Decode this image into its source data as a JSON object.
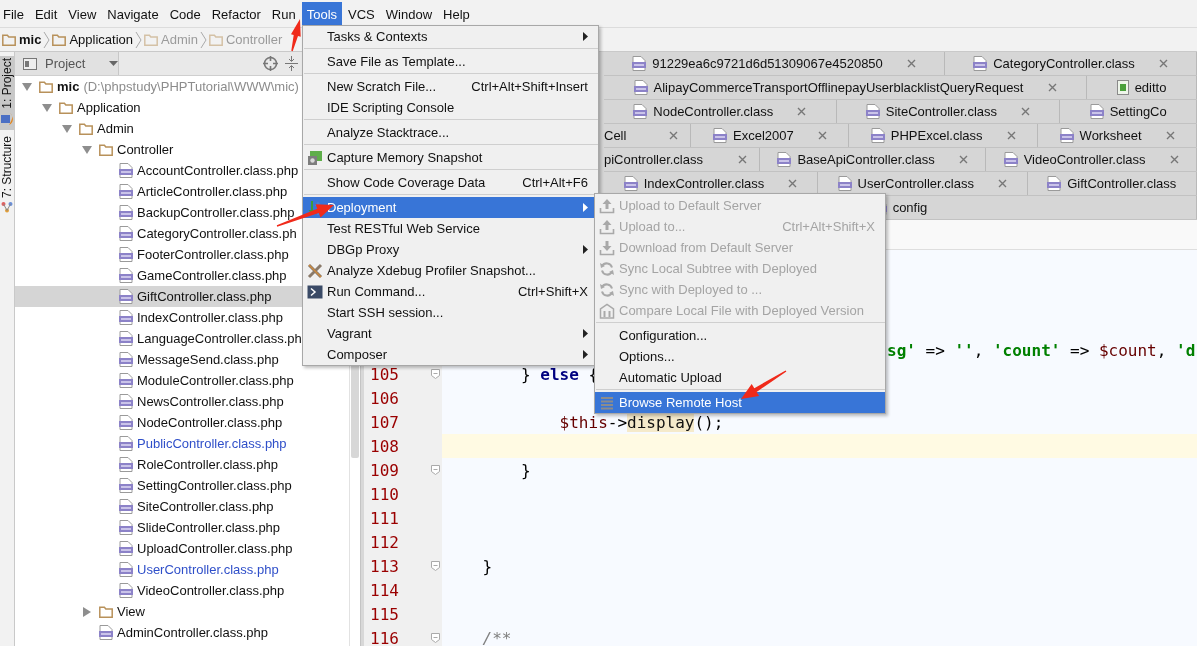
{
  "menubar": [
    {
      "label": "File",
      "selected": false
    },
    {
      "label": "Edit",
      "selected": false
    },
    {
      "label": "View",
      "selected": false
    },
    {
      "label": "Navigate",
      "selected": false
    },
    {
      "label": "Code",
      "selected": false
    },
    {
      "label": "Refactor",
      "selected": false
    },
    {
      "label": "Run",
      "selected": false
    },
    {
      "label": "Tools",
      "selected": true
    },
    {
      "label": "VCS",
      "selected": false
    },
    {
      "label": "Window",
      "selected": false
    },
    {
      "label": "Help",
      "selected": false
    }
  ],
  "breadcrumbs": [
    {
      "label": "mic",
      "bold": true,
      "dimmed": false
    },
    {
      "label": "Application",
      "bold": false,
      "dimmed": false
    },
    {
      "label": "Admin",
      "bold": false,
      "dimmed": true
    },
    {
      "label": "Controller",
      "bold": false,
      "dimmed": true
    }
  ],
  "tool_strip": [
    {
      "label": "1: Project",
      "selected": true
    },
    {
      "label": "7: Structure",
      "selected": false
    }
  ],
  "project_panel": {
    "title": "Project",
    "tree": [
      {
        "label": "mic",
        "kind": "module",
        "path": "(D:\\phpstudy\\PHPTutorial\\WWW\\mic)",
        "expanded": true,
        "selected": false,
        "children": [
          {
            "label": "Application",
            "kind": "folder",
            "expanded": true,
            "selected": false,
            "children": [
              {
                "label": "Admin",
                "kind": "folder",
                "expanded": true,
                "selected": false,
                "children": [
                  {
                    "label": "Controller",
                    "kind": "folder",
                    "expanded": true,
                    "selected": false,
                    "children": [
                      {
                        "label": "AccountController.class.php",
                        "kind": "file",
                        "modified": false,
                        "selected": false
                      },
                      {
                        "label": "ArticleController.class.php",
                        "kind": "file",
                        "modified": false,
                        "selected": false
                      },
                      {
                        "label": "BackupController.class.php",
                        "kind": "file",
                        "modified": false,
                        "selected": false
                      },
                      {
                        "label": "CategoryController.class.ph",
                        "kind": "file",
                        "modified": false,
                        "selected": false
                      },
                      {
                        "label": "FooterController.class.php",
                        "kind": "file",
                        "modified": false,
                        "selected": false
                      },
                      {
                        "label": "GameController.class.php",
                        "kind": "file",
                        "modified": false,
                        "selected": false
                      },
                      {
                        "label": "GiftController.class.php",
                        "kind": "file",
                        "modified": false,
                        "selected": true
                      },
                      {
                        "label": "IndexController.class.php",
                        "kind": "file",
                        "modified": false,
                        "selected": false
                      },
                      {
                        "label": "LanguageController.class.ph",
                        "kind": "file",
                        "modified": false,
                        "selected": false
                      },
                      {
                        "label": "MessageSend.class.php",
                        "kind": "file",
                        "modified": false,
                        "selected": false
                      },
                      {
                        "label": "ModuleController.class.php",
                        "kind": "file",
                        "modified": false,
                        "selected": false
                      },
                      {
                        "label": "NewsController.class.php",
                        "kind": "file",
                        "modified": false,
                        "selected": false
                      },
                      {
                        "label": "NodeController.class.php",
                        "kind": "file",
                        "modified": false,
                        "selected": false
                      },
                      {
                        "label": "PublicController.class.php",
                        "kind": "file",
                        "modified": true,
                        "selected": false
                      },
                      {
                        "label": "RoleController.class.php",
                        "kind": "file",
                        "modified": false,
                        "selected": false
                      },
                      {
                        "label": "SettingController.class.php",
                        "kind": "file",
                        "modified": false,
                        "selected": false
                      },
                      {
                        "label": "SiteController.class.php",
                        "kind": "file",
                        "modified": false,
                        "selected": false
                      },
                      {
                        "label": "SlideController.class.php",
                        "kind": "file",
                        "modified": false,
                        "selected": false
                      },
                      {
                        "label": "UploadController.class.php",
                        "kind": "file",
                        "modified": false,
                        "selected": false
                      },
                      {
                        "label": "UserController.class.php",
                        "kind": "file",
                        "modified": true,
                        "selected": false
                      },
                      {
                        "label": "VideoController.class.php",
                        "kind": "file",
                        "modified": false,
                        "selected": false
                      }
                    ]
                  },
                  {
                    "label": "View",
                    "kind": "folder",
                    "expanded": false,
                    "selected": false
                  },
                  {
                    "label": "AdminController.class.php",
                    "kind": "file",
                    "modified": false,
                    "selected": false
                  }
                ]
              }
            ]
          }
        ]
      }
    ]
  },
  "editor": {
    "tab_rows": [
      {
        "tabs": [
          {
            "kind": "php",
            "label": "91229ea6c9721d6d51309067e4520850",
            "closable": true,
            "selected": false
          },
          {
            "kind": "php",
            "label": "CategoryController.class",
            "closable": true,
            "selected": false
          }
        ]
      },
      {
        "tabs": [
          {
            "kind": "php",
            "label": "AlipayCommerceTransportOfflinepayUserblacklistQueryRequest",
            "closable": true,
            "selected": false
          },
          {
            "kind": "html",
            "label": "editto",
            "closable": false,
            "selected": false
          }
        ]
      },
      {
        "tabs": [
          {
            "kind": "php",
            "label": "NodeController.class",
            "closable": true,
            "selected": false
          },
          {
            "kind": "php",
            "label": "SiteController.class",
            "closable": true,
            "selected": false
          },
          {
            "kind": "php",
            "label": "SettingCo",
            "closable": false,
            "selected": false
          }
        ]
      },
      {
        "tabs": [
          {
            "kind": "partial",
            "label": "Cell",
            "closable": true,
            "selected": false
          },
          {
            "kind": "php",
            "label": "Excel2007",
            "closable": true,
            "selected": false
          },
          {
            "kind": "php",
            "label": "PHPExcel.class",
            "closable": true,
            "selected": false
          },
          {
            "kind": "php",
            "label": "Worksheet",
            "closable": true,
            "selected": false
          }
        ]
      },
      {
        "tabs": [
          {
            "kind": "partial",
            "label": "piController.class",
            "closable": true,
            "selected": false
          },
          {
            "kind": "php",
            "label": "BaseApiController.class",
            "closable": true,
            "selected": false
          },
          {
            "kind": "php",
            "label": "VideoController.class",
            "closable": true,
            "selected": false
          }
        ]
      },
      {
        "tabs": [
          {
            "kind": "php",
            "label": "IndexController.class",
            "closable": true,
            "selected": false
          },
          {
            "kind": "php",
            "label": "UserController.class",
            "closable": true,
            "selected": false
          },
          {
            "kind": "php",
            "label": "GiftController.class",
            "closable": false,
            "selected": false
          }
        ]
      },
      {
        "tabs": [
          {
            "kind": "php",
            "label": "config",
            "closable": false,
            "selected": false
          }
        ]
      }
    ],
    "code_lines": [
      {
        "kind": "fragment",
        "tokens": [
          {
            "text": "sg'",
            "kind": "string"
          },
          {
            "text": " => ",
            "kind": "plain"
          },
          {
            "text": "''",
            "kind": "string"
          },
          {
            "text": ", ",
            "kind": "plain"
          },
          {
            "text": "'count'",
            "kind": "string"
          },
          {
            "text": " => ",
            "kind": "plain"
          },
          {
            "text": "$count",
            "kind": "var"
          },
          {
            "text": ", ",
            "kind": "plain"
          },
          {
            "text": "'d",
            "kind": "string"
          }
        ]
      },
      {
        "kind": "line",
        "number": "105",
        "fold": true,
        "current": false,
        "tokens": [
          {
            "text": "        } ",
            "kind": "plain"
          },
          {
            "text": "else",
            "kind": "keyword"
          },
          {
            "text": " {",
            "kind": "plain"
          }
        ]
      },
      {
        "kind": "line",
        "number": "106",
        "fold": false,
        "current": false
      },
      {
        "kind": "line",
        "number": "107",
        "fold": false,
        "current": false,
        "tokens": [
          {
            "text": "            $this",
            "kind": "var"
          },
          {
            "text": "->",
            "kind": "plain"
          },
          {
            "text": "display",
            "kind": "match"
          },
          {
            "text": "();",
            "kind": "plain"
          }
        ]
      },
      {
        "kind": "line",
        "number": "108",
        "fold": false,
        "current": true
      },
      {
        "kind": "line",
        "number": "109",
        "fold": true,
        "current": false,
        "tokens": [
          {
            "text": "        }",
            "kind": "plain"
          }
        ]
      },
      {
        "kind": "line",
        "number": "110",
        "fold": false,
        "current": false
      },
      {
        "kind": "line",
        "number": "111",
        "fold": false,
        "current": false
      },
      {
        "kind": "line",
        "number": "112",
        "fold": false,
        "current": false
      },
      {
        "kind": "line",
        "number": "113",
        "fold": true,
        "current": false,
        "tokens": [
          {
            "text": "    }",
            "kind": "plain"
          }
        ]
      },
      {
        "kind": "line",
        "number": "114",
        "fold": false,
        "current": false
      },
      {
        "kind": "line",
        "number": "115",
        "fold": false,
        "current": false
      },
      {
        "kind": "line",
        "number": "116",
        "fold": true,
        "current": false,
        "tokens": [
          {
            "text": "    /**",
            "kind": "comment"
          }
        ]
      }
    ]
  },
  "tools_menu": [
    {
      "kind": "item",
      "label": "Tasks & Contexts",
      "submenu": true,
      "selected": false
    },
    {
      "kind": "separator"
    },
    {
      "kind": "item",
      "label": "Save File as Template...",
      "selected": false
    },
    {
      "kind": "separator"
    },
    {
      "kind": "item",
      "label": "New Scratch File...",
      "shortcut": "Ctrl+Alt+Shift+Insert",
      "selected": false
    },
    {
      "kind": "item",
      "label": "IDE Scripting Console",
      "selected": false
    },
    {
      "kind": "separator"
    },
    {
      "kind": "item",
      "label": "Analyze Stacktrace...",
      "selected": false
    },
    {
      "kind": "separator"
    },
    {
      "kind": "chip",
      "label": "Capture Memory Snapshot",
      "selected": false
    },
    {
      "kind": "separator"
    },
    {
      "kind": "item",
      "label": "Show Code Coverage Data",
      "shortcut": "Ctrl+Alt+F6",
      "selected": false
    },
    {
      "kind": "separator"
    },
    {
      "kind": "deploy",
      "label": "Deployment",
      "submenu": true,
      "selected": true
    },
    {
      "kind": "item",
      "label": "Test RESTful Web Service",
      "selected": false
    },
    {
      "kind": "item",
      "label": "DBGp Proxy",
      "submenu": true,
      "selected": false
    },
    {
      "kind": "cross",
      "label": "Analyze Xdebug Profiler Snapshot...",
      "selected": false
    },
    {
      "kind": "terminal",
      "label": "Run Command...",
      "shortcut": "Ctrl+Shift+X",
      "selected": false
    },
    {
      "kind": "item",
      "label": "Start SSH session...",
      "selected": false
    },
    {
      "kind": "item",
      "label": "Vagrant",
      "submenu": true,
      "selected": false
    },
    {
      "kind": "item",
      "label": "Composer",
      "submenu": true,
      "selected": false
    }
  ],
  "deployment_submenu": [
    {
      "kind": "upload",
      "label": "Upload to Default Server",
      "disabled": true,
      "selected": false
    },
    {
      "kind": "upload",
      "label": "Upload to...",
      "shortcut": "Ctrl+Alt+Shift+X",
      "disabled": true,
      "selected": false
    },
    {
      "kind": "download",
      "label": "Download from Default Server",
      "disabled": true,
      "selected": false
    },
    {
      "kind": "sync",
      "label": "Sync Local Subtree with Deployed",
      "disabled": true,
      "selected": false
    },
    {
      "kind": "sync",
      "label": "Sync with Deployed to ...",
      "disabled": true,
      "selected": false
    },
    {
      "kind": "compare",
      "label": "Compare Local File with Deployed Version",
      "disabled": true,
      "selected": false
    },
    {
      "kind": "separator"
    },
    {
      "kind": "item",
      "label": "Configuration...",
      "disabled": false,
      "selected": false
    },
    {
      "kind": "item",
      "label": "Options...",
      "disabled": false,
      "selected": false
    },
    {
      "kind": "item",
      "label": "Automatic Upload",
      "disabled": false,
      "selected": false
    },
    {
      "kind": "separator"
    },
    {
      "kind": "list",
      "label": "Browse Remote Host",
      "disabled": false,
      "selected": true
    }
  ]
}
